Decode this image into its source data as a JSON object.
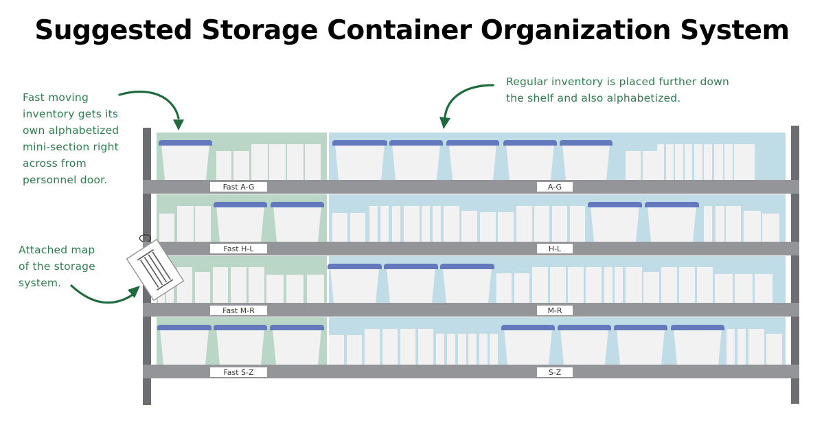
{
  "title": "Suggested Storage Container Organization System",
  "annotations": {
    "fast_moving": "Fast moving\ninventory gets its\nown alphabetized\nmini-section right\nacross from\npersonnel door.",
    "regular": "Regular inventory is placed further down\nthe shelf and also alphabetized.",
    "map": "Attached map\nof the storage\nsystem."
  },
  "shelves": [
    {
      "fast_label": "Fast A-G",
      "regular_label": "A-G"
    },
    {
      "fast_label": "Fast H-L",
      "regular_label": "H-L"
    },
    {
      "fast_label": "Fast M-R",
      "regular_label": "M-R"
    },
    {
      "fast_label": "Fast S-Z",
      "regular_label": "S-Z"
    }
  ],
  "colors": {
    "fast_section": "#b9d6c7",
    "regular_section": "#c0dce6",
    "shelf_bar": "#939598",
    "post": "#6d6e71",
    "bin_lid": "#6479bd",
    "bin_body": "#f2f2f2",
    "annotation": "#2e7d4f",
    "arrow": "#1f6b3e"
  }
}
